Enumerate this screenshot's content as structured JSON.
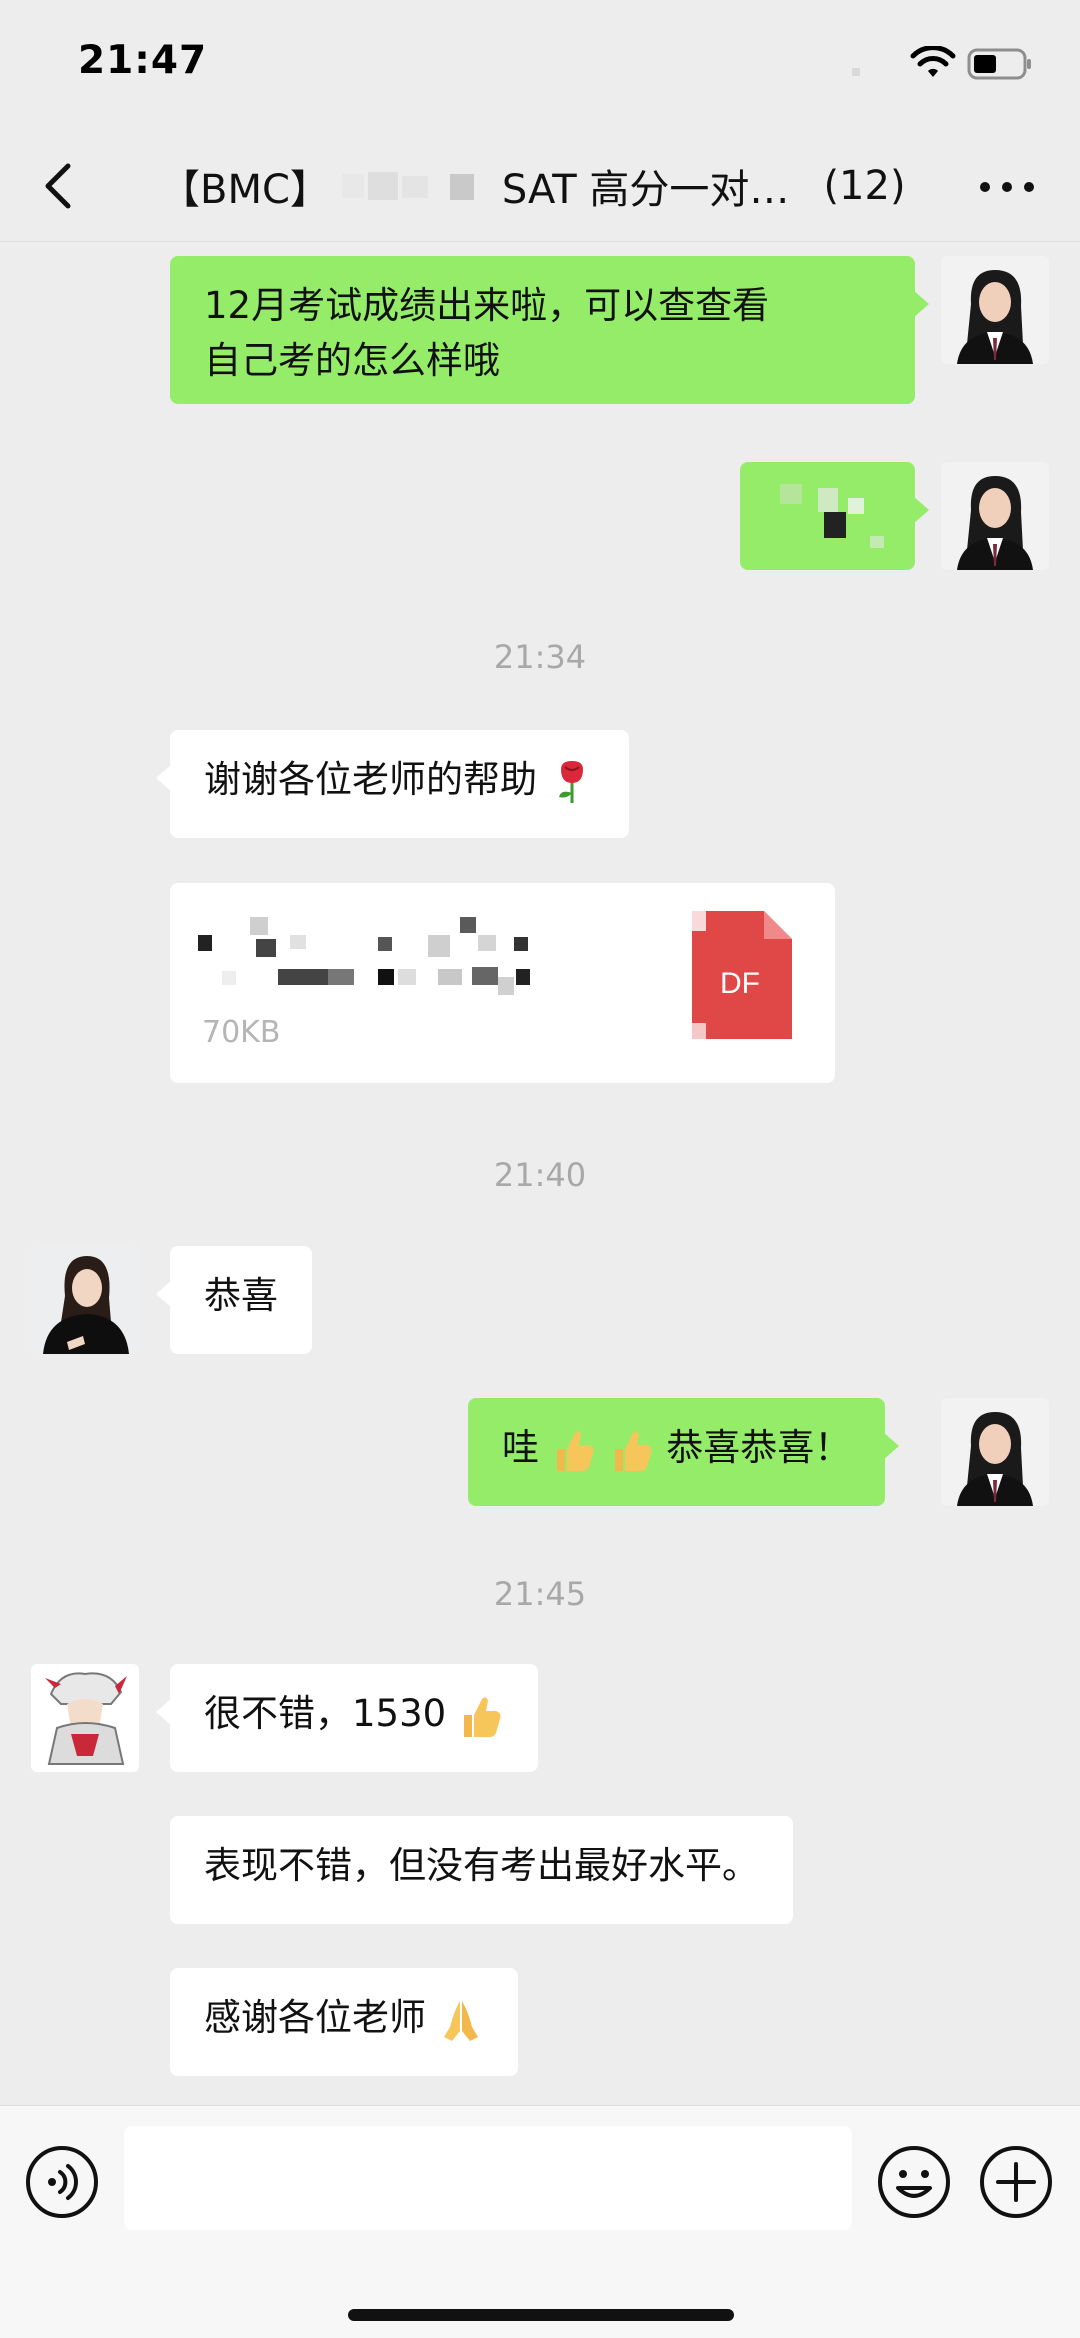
{
  "status_bar": {
    "time": "21:47"
  },
  "header": {
    "title_prefix": "【BMC】",
    "title_suffix": "SAT 高分一对…",
    "member_count": "(12)"
  },
  "messages": [
    {
      "id": "m1",
      "side": "right",
      "text_line1": "12月考试成绩出来啦，可以查查看",
      "text_line2": "自己考的怎么样哦"
    },
    {
      "id": "m2",
      "side": "right",
      "text": ""
    },
    {
      "id": "t1",
      "type": "timestamp",
      "text": "21:34"
    },
    {
      "id": "m3",
      "side": "left",
      "text": "谢谢各位老师的帮助",
      "emoji": "rose-emoji"
    },
    {
      "id": "m4",
      "side": "left",
      "type": "file",
      "file_size": "70KB",
      "file_icon_label": "DF"
    },
    {
      "id": "t2",
      "type": "timestamp",
      "text": "21:40"
    },
    {
      "id": "m5",
      "side": "left",
      "text": "恭喜"
    },
    {
      "id": "m6",
      "side": "right",
      "text_before": "哇",
      "text_after": "恭喜恭喜！",
      "emoji": "thumbs-up-emoji"
    },
    {
      "id": "t3",
      "type": "timestamp",
      "text": "21:45"
    },
    {
      "id": "m7",
      "side": "left",
      "text": "很不错，1530",
      "emoji": "thumbs-up-emoji"
    },
    {
      "id": "m8",
      "side": "left",
      "text": "表现不错，但没有考出最好水平。"
    },
    {
      "id": "m9",
      "side": "left",
      "text": "感谢各位老师",
      "emoji": "pray-emoji"
    }
  ],
  "input": {
    "placeholder": ""
  },
  "colors": {
    "background": "#ededed",
    "bubble_self": "#95ec69",
    "bubble_other": "#ffffff",
    "timestamp": "#a8a8a8"
  }
}
